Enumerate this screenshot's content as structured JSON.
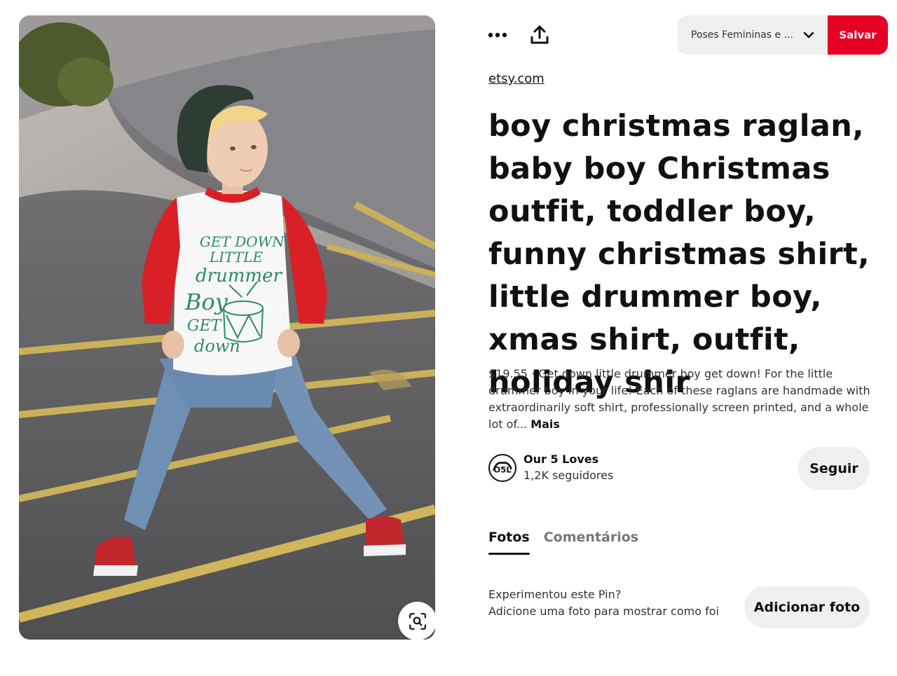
{
  "toolbar": {
    "more_icon": "more-horizontal-icon",
    "share_icon": "share-upload-icon",
    "board_name": "Poses Femininas e ...",
    "save_label": "Salvar",
    "accent_color": "#e60023"
  },
  "pin": {
    "source": "etsy.com",
    "title": "boy christmas raglan, baby boy Christmas outfit, toddler boy, funny christmas shirt, little drummer boy, xmas shirt, outfit, holiday shir",
    "description": "$19.55 · Get down little drummer boy get down! For the little drummer boy in your life! Each of these raglans are handmade with extraordinarily soft shirt, professionally screen printed, and a whole lot of...",
    "more_label": "Mais",
    "shirt_text": [
      "GET DOWN",
      "LITTLE",
      "drummer",
      "Boy",
      "GET",
      "down"
    ]
  },
  "creator": {
    "avatar_text": "O5L",
    "name": "Our 5 Loves",
    "followers": "1,2K seguidores",
    "follow_label": "Seguir"
  },
  "tabs": [
    {
      "label": "Fotos",
      "active": true
    },
    {
      "label": "Comentários",
      "active": false
    }
  ],
  "tried": {
    "line1": "Experimentou este Pin?",
    "line2": "Adicione uma foto para mostrar como foi",
    "button_label": "Adicionar foto"
  },
  "image": {
    "lens_icon": "visual-search-icon"
  }
}
